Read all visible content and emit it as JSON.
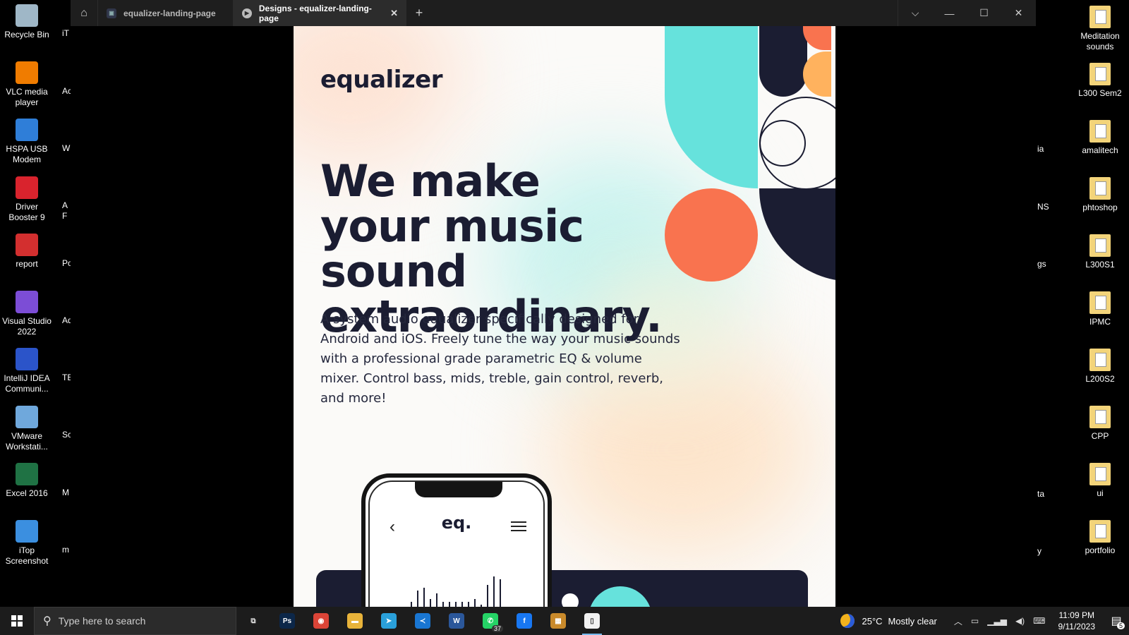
{
  "desktop": {
    "left_icons": [
      {
        "label": "Recycle Bin",
        "icon": "recycle-bin-icon",
        "color": "#9fb7c7"
      },
      {
        "label": "VLC media player",
        "icon": "vlc-icon",
        "color": "#f07c00"
      },
      {
        "label": "HSPA USB Modem",
        "icon": "globe-icon",
        "color": "#2f7ed8"
      },
      {
        "label": "Driver Booster 9",
        "icon": "driver-booster-icon",
        "color": "#d9232d"
      },
      {
        "label": "report",
        "icon": "pdf-icon",
        "color": "#d32f2f"
      },
      {
        "label": "Visual Studio 2022",
        "icon": "visual-studio-icon",
        "color": "#7c4dd6"
      },
      {
        "label": "IntelliJ IDEA Communi...",
        "icon": "intellij-icon",
        "color": "#2b54c9"
      },
      {
        "label": "VMware Workstati...",
        "icon": "vmware-icon",
        "color": "#6fa8dc"
      },
      {
        "label": "Excel 2016",
        "icon": "excel-icon",
        "color": "#1f7244"
      },
      {
        "label": "iTop Screenshot",
        "icon": "itop-screenshot-icon",
        "color": "#3b8fe0"
      }
    ],
    "left_peek": [
      "iT",
      "Ac",
      "WI",
      "A",
      "F",
      "Pov",
      "Adt",
      "TE",
      "Sc",
      "M",
      "m"
    ],
    "right_icons": [
      {
        "label": "Meditation sounds",
        "icon": "folder-icon"
      },
      {
        "label": "L300 Sem2",
        "icon": "folder-icon"
      },
      {
        "label": "amalitech",
        "icon": "folder-icon"
      },
      {
        "label": "phtoshop",
        "icon": "folder-icon"
      },
      {
        "label": "L300S1",
        "icon": "folder-icon"
      },
      {
        "label": "IPMC",
        "icon": "folder-icon"
      },
      {
        "label": "L200S2",
        "icon": "folder-icon"
      },
      {
        "label": "CPP",
        "icon": "folder-icon"
      },
      {
        "label": "ui",
        "icon": "folder-icon"
      },
      {
        "label": "portfolio",
        "icon": "folder-icon"
      }
    ],
    "right_peek": [
      "ia",
      "NS",
      "gs",
      "ta",
      "y"
    ]
  },
  "window": {
    "home_icon": "home-icon",
    "tabs": [
      {
        "label": "equalizer-landing-page",
        "active": false
      },
      {
        "label": "Designs - equalizer-landing-page",
        "active": true
      }
    ],
    "close_tab_glyph": "✕",
    "add_tab_glyph": "+",
    "controls": {
      "dropdown": "⌵",
      "minimize": "—",
      "maximize": "☐",
      "close": "✕"
    }
  },
  "design": {
    "logo": "equalizer",
    "headline": "We make your music sound extraordinary.",
    "body": "A system audio equalizer specifically designed for Android and iOS. Freely tune the way your music sounds with a professional grade parametric EQ & volume mixer. Control bass, mids, treble, gain control, reverb, and more!",
    "phone": {
      "back": "‹",
      "logo": "eq."
    },
    "eq_bars": [
      0.3,
      0.5,
      0.55,
      0.35,
      0.45,
      0.3,
      0.3,
      0.3,
      0.3,
      0.3,
      0.35,
      0.25,
      0.6,
      0.75,
      0.7
    ],
    "colors": {
      "dark": "#1b1d32",
      "teal": "#66e2dc",
      "coral": "#f9734f",
      "orange": "#ffb25e",
      "bg": "#fbfaf8"
    }
  },
  "taskbar": {
    "search_placeholder": "Type here to search",
    "apps": [
      {
        "name": "task-view",
        "glyph": "⧉",
        "color": "transparent"
      },
      {
        "name": "photoshop",
        "glyph": "Ps",
        "color": "#0c2749"
      },
      {
        "name": "chrome",
        "glyph": "◉",
        "color": "#db4437"
      },
      {
        "name": "file-explorer",
        "glyph": "▬",
        "color": "#e8b33a"
      },
      {
        "name": "telegram",
        "glyph": "➤",
        "color": "#2aa0da"
      },
      {
        "name": "vscode",
        "glyph": "≺",
        "color": "#1976d2"
      },
      {
        "name": "word",
        "glyph": "W",
        "color": "#2b579a"
      },
      {
        "name": "whatsapp",
        "glyph": "✆",
        "color": "#25d366",
        "badge": "37"
      },
      {
        "name": "facebook",
        "glyph": "f",
        "color": "#1877f2"
      },
      {
        "name": "paint-app",
        "glyph": "▦",
        "color": "#c98a2b"
      },
      {
        "name": "notepad",
        "glyph": "▯",
        "color": "#f2f2f2",
        "active": true
      }
    ],
    "weather": {
      "temp": "25°C",
      "desc": "Mostly clear"
    },
    "time": "11:09 PM",
    "date": "9/11/2023",
    "notifications": "5"
  }
}
